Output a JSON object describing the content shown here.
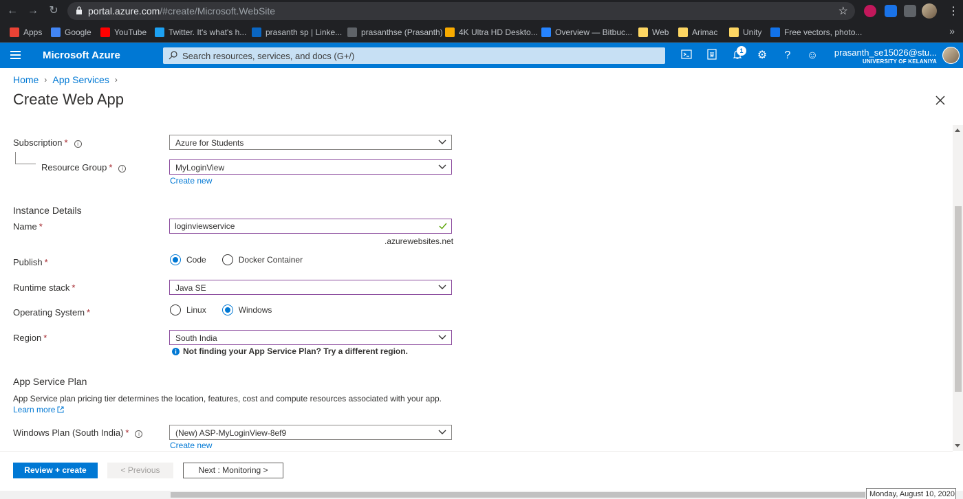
{
  "browser": {
    "url_host": "portal.azure.com",
    "url_path": "/#create/Microsoft.WebSite",
    "bookmarks": [
      {
        "label": "Apps",
        "color": "#ea4335"
      },
      {
        "label": "Google",
        "color": "#4285f4"
      },
      {
        "label": "YouTube",
        "color": "#ff0000"
      },
      {
        "label": "Twitter. It's what's h...",
        "color": "#1da1f2"
      },
      {
        "label": "prasanth sp | Linke...",
        "color": "#0a66c2"
      },
      {
        "label": "prasanthse (Prasanth)",
        "color": "#5f6368"
      },
      {
        "label": "4K Ultra HD Deskto...",
        "color": "#f9ab00"
      },
      {
        "label": "Overview — Bitbuc...",
        "color": "#2684ff"
      },
      {
        "label": "Web",
        "color": "#fdd663"
      },
      {
        "label": "Arimac",
        "color": "#fdd663"
      },
      {
        "label": "Unity",
        "color": "#fdd663"
      },
      {
        "label": "Free vectors, photo...",
        "color": "#1273eb"
      }
    ]
  },
  "header": {
    "brand": "Microsoft Azure",
    "search_placeholder": "Search resources, services, and docs (G+/)",
    "notification_count": "1",
    "user_name": "prasanth_se15026@stu...",
    "user_org": "UNIVERSITY OF KELANIYA"
  },
  "breadcrumb": [
    "Home",
    "App Services"
  ],
  "page_title": "Create Web App",
  "form": {
    "subscription": {
      "label": "Subscription",
      "value": "Azure for Students"
    },
    "resource_group": {
      "label": "Resource Group",
      "value": "MyLoginView",
      "create_new": "Create new"
    },
    "instance_section": "Instance Details",
    "name": {
      "label": "Name",
      "value": "loginviewservice",
      "suffix": ".azurewebsites.net"
    },
    "publish": {
      "label": "Publish",
      "options": [
        "Code",
        "Docker Container"
      ],
      "selected": "Code"
    },
    "runtime": {
      "label": "Runtime stack",
      "value": "Java SE"
    },
    "os": {
      "label": "Operating System",
      "options": [
        "Linux",
        "Windows"
      ],
      "selected": "Windows"
    },
    "region": {
      "label": "Region",
      "value": "South India",
      "info": "Not finding your App Service Plan? Try a different region."
    },
    "plan_section": "App Service Plan",
    "plan_desc": "App Service plan pricing tier determines the location, features, cost and compute resources associated with your app.",
    "learn_more": "Learn more",
    "windows_plan": {
      "label": "Windows Plan (South India)",
      "value": "(New) ASP-MyLoginView-8ef9",
      "create_new": "Create new"
    }
  },
  "footer": {
    "review_create": "Review + create",
    "previous": "< Previous",
    "next": "Next : Monitoring >"
  },
  "tooltip": "Monday, August 10, 2020",
  "colors": {
    "azure_blue": "#0078d4",
    "focus_border": "#8c4c9e",
    "required": "#a4262c"
  }
}
